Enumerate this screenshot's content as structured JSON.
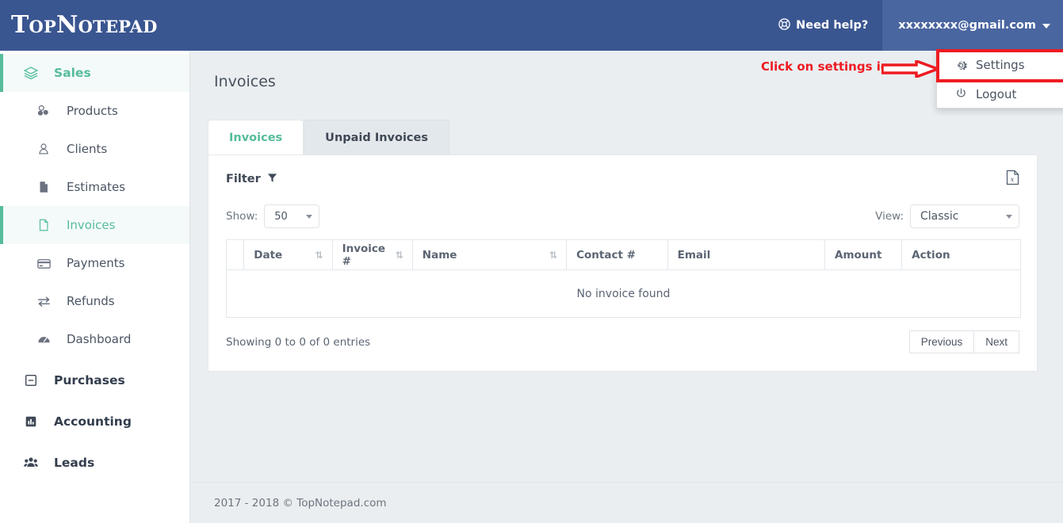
{
  "header": {
    "logo": "TopNotepad",
    "need_help_label": "Need help?",
    "need_help_icon": "life-ring-icon",
    "user_email": "xxxxxxxx@gmail.com",
    "bg_color": "#3a5691",
    "user_menu_bg_color": "#4a66a0"
  },
  "user_dropdown": {
    "items": [
      {
        "label": "Settings",
        "icon": "gear-icon"
      },
      {
        "label": "Logout",
        "icon": "power-icon"
      }
    ]
  },
  "annotation": {
    "text": "Click on settings icon",
    "color": "#ee1b22",
    "arrow": "right-arrow-icon",
    "highlight_target": "Settings"
  },
  "sidebar": {
    "items": [
      {
        "label": "Sales",
        "icon": "layers-icon",
        "type": "group",
        "active": true
      },
      {
        "label": "Products",
        "icon": "cubes-icon",
        "type": "sub",
        "active": false
      },
      {
        "label": "Clients",
        "icon": "user-icon",
        "type": "sub",
        "active": false
      },
      {
        "label": "Estimates",
        "icon": "file-icon",
        "type": "sub",
        "active": false
      },
      {
        "label": "Invoices",
        "icon": "file-outline-icon",
        "type": "sub",
        "active": true
      },
      {
        "label": "Payments",
        "icon": "credit-card-icon",
        "type": "sub",
        "active": false
      },
      {
        "label": "Refunds",
        "icon": "exchange-icon",
        "type": "sub",
        "active": false
      },
      {
        "label": "Dashboard",
        "icon": "dashboard-icon",
        "type": "sub",
        "active": false
      },
      {
        "label": "Purchases",
        "icon": "minus-square-icon",
        "type": "group",
        "active": false
      },
      {
        "label": "Accounting",
        "icon": "bar-chart-icon",
        "type": "group",
        "active": false
      },
      {
        "label": "Leads",
        "icon": "users-icon",
        "type": "group",
        "active": false
      }
    ],
    "accent_color": "#56bc9c"
  },
  "main": {
    "page_title": "Invoices",
    "tabs": [
      {
        "label": "Invoices",
        "active": true
      },
      {
        "label": "Unpaid Invoices",
        "active": false
      }
    ],
    "filter_label": "Filter",
    "filter_icon": "funnel-icon",
    "export_icon": "excel-export-icon",
    "show_label": "Show:",
    "show_value": "50",
    "view_label": "View:",
    "view_value": "Classic",
    "table": {
      "columns": [
        {
          "label": "",
          "sortable": false
        },
        {
          "label": "Date",
          "sortable": true
        },
        {
          "label": "Invoice #",
          "sortable": true
        },
        {
          "label": "Name",
          "sortable": true
        },
        {
          "label": "Contact #",
          "sortable": false
        },
        {
          "label": "Email",
          "sortable": false
        },
        {
          "label": "Amount",
          "sortable": false
        },
        {
          "label": "Action",
          "sortable": false
        }
      ],
      "rows": [],
      "empty_message": "No invoice found"
    },
    "entries_info": "Showing 0 to 0 of 0 entries",
    "pagination": {
      "previous_label": "Previous",
      "next_label": "Next"
    }
  },
  "footer": {
    "text": "2017 - 2018 © TopNotepad.com"
  }
}
